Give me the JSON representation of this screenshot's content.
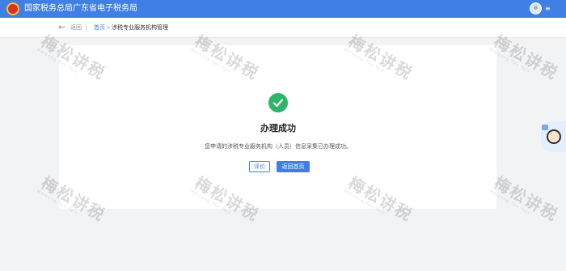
{
  "header": {
    "site_title": "国家税务总局广东省电子税务局",
    "user_menu_caret": "≡"
  },
  "nav": {
    "back_arrow": "←",
    "back_label": "返回",
    "breadcrumb_home": "首页",
    "breadcrumb_separator": ">",
    "breadcrumb_current": "涉税专业服务机构管理"
  },
  "result": {
    "title": "办理成功",
    "message": "您申请的涉税专业服务机构（人员）信息采集已办理成功。",
    "rate_button": "评价",
    "home_button": "返回首页"
  },
  "watermark": {
    "text": "梅松讲税",
    "subtext": "Meisong Tax Talk"
  },
  "colors": {
    "header_bg": "#3f7fe6",
    "success": "#2fb56a",
    "primary": "#3f7fe6"
  },
  "icons": {
    "success": "check-circle-icon",
    "back": "arrow-left-icon",
    "assistant": "assistant-avatar-icon",
    "emblem": "tax-emblem-icon"
  }
}
